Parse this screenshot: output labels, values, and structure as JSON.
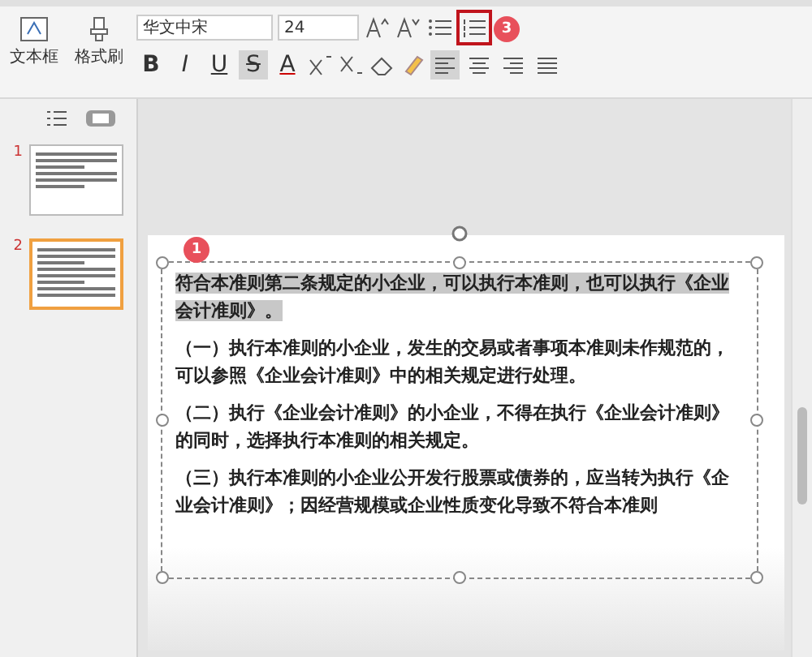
{
  "toolbar": {
    "textbox_label": "文本框",
    "painter_label": "格式刷",
    "font": "华文中宋",
    "size": "24",
    "format_buttons": [
      {
        "kind": "bold",
        "text": "B",
        "on": false
      },
      {
        "kind": "italic",
        "text": "I",
        "on": false
      },
      {
        "kind": "underline",
        "text": "U",
        "on": false
      },
      {
        "kind": "strike",
        "text": "S",
        "on": true
      },
      {
        "kind": "color",
        "text": "A",
        "on": false
      }
    ],
    "align_buttons": [
      {
        "kind": "left",
        "on": true
      },
      {
        "kind": "center",
        "on": false
      },
      {
        "kind": "right",
        "on": false
      },
      {
        "kind": "justify",
        "on": false
      }
    ],
    "list_buttons": [
      {
        "kind": "bullets",
        "marked": false
      },
      {
        "kind": "numbers",
        "marked": true
      }
    ],
    "step_badge": "3"
  },
  "slides": [
    {
      "number": "1",
      "selected": false
    },
    {
      "number": "2",
      "selected": true
    }
  ],
  "slide": {
    "step_badge": "1",
    "paragraphs": [
      {
        "text": "符合本准则第二条规定的小企业，可以执行本准则，也可以执行《企业会计准则》。",
        "selected": true
      },
      {
        "text": "（一）执行本准则的小企业，发生的交易或者事项本准则未作规范的，可以参照《企业会计准则》中的相关规定进行处理。",
        "selected": false
      },
      {
        "text": "（二）执行《企业会计准则》的小企业，不得在执行《企业会计准则》的同时，选择执行本准则的相关规定。",
        "selected": false
      },
      {
        "text": "（三）执行本准则的小企业公开发行股票或债券的，应当转为执行《企业会计准则》；因经营规模或企业性质变化导致不符合本准则",
        "selected": false
      }
    ]
  }
}
